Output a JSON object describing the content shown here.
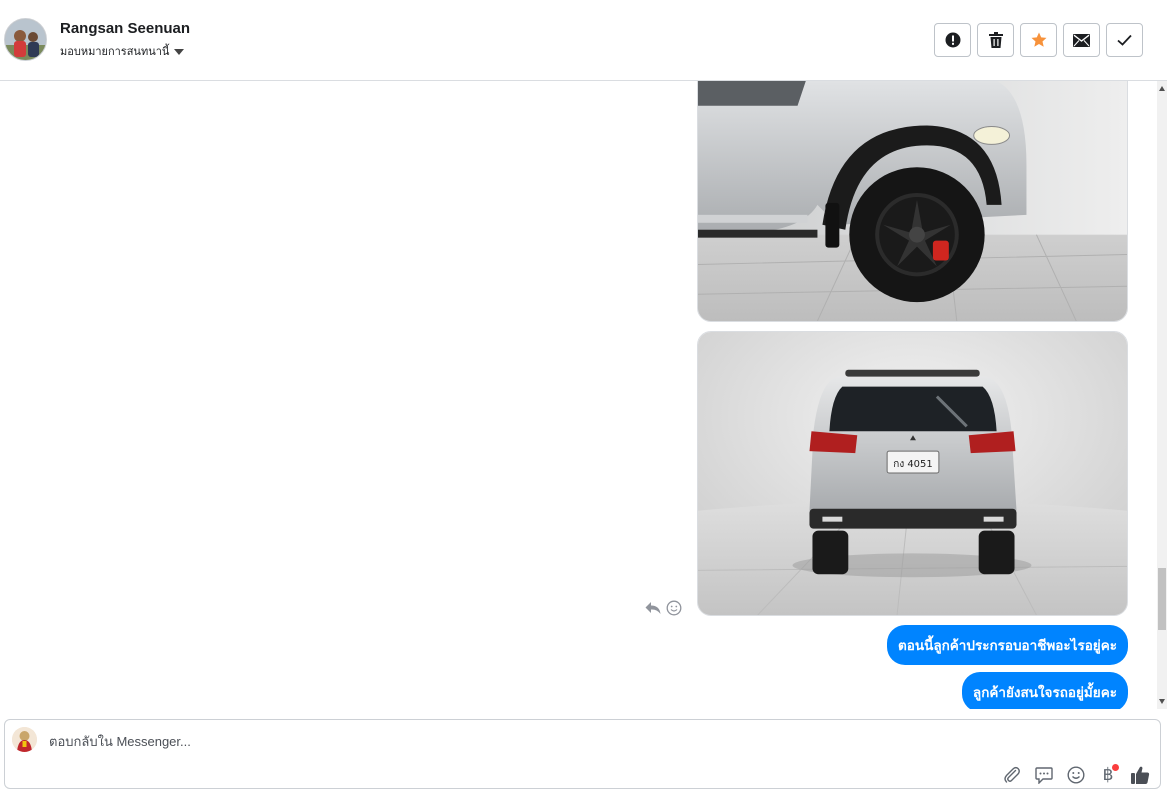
{
  "header": {
    "contact_name": "Rangsan Seenuan",
    "assign_label": "มอบหมายการสนทนานี้",
    "actions": [
      {
        "icon": "spam-icon"
      },
      {
        "icon": "trash-icon"
      },
      {
        "icon": "star-icon",
        "color": "#f7923b"
      },
      {
        "icon": "envelope-icon"
      },
      {
        "icon": "check-icon"
      }
    ]
  },
  "thread": {
    "messages": [
      {
        "type": "image",
        "subject": "car-front-wheel"
      },
      {
        "type": "image",
        "subject": "car-rear-view",
        "plate_text": "กง 4051"
      },
      {
        "type": "text",
        "text": "ตอนนี้ลูกค้าประกรอบอาชีพอะไรอยู่คะ"
      },
      {
        "type": "text",
        "text": "ลูกค้ายังสนใจรถอยู่มั้ยคะ"
      }
    ],
    "bubble_color": "#0084ff"
  },
  "composer": {
    "placeholder": "ตอบกลับใน Messenger...",
    "tools": [
      "attachment-icon",
      "saved-reply-icon",
      "emoji-icon",
      "payment-icon",
      "like-icon"
    ]
  }
}
